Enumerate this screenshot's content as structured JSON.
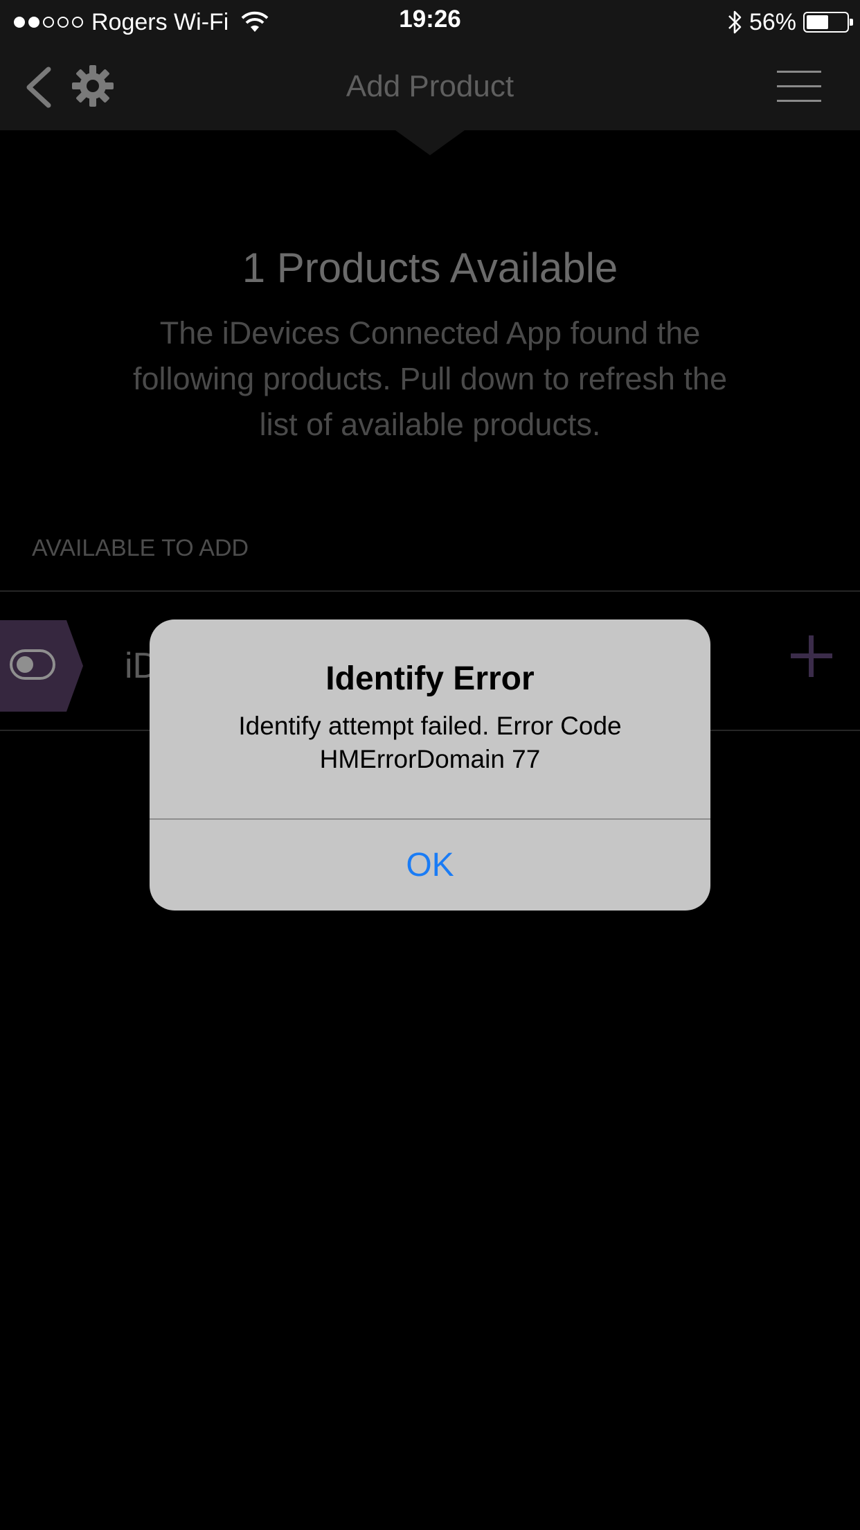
{
  "status_bar": {
    "signal_filled": 2,
    "signal_total": 5,
    "carrier": "Rogers Wi-Fi",
    "time": "19:26",
    "battery_percent": "56%",
    "battery_level": 0.56
  },
  "nav": {
    "title": "Add Product",
    "back_icon": "chevron-left-icon",
    "gear_icon": "gear-icon",
    "menu_icon": "hamburger-menu-icon"
  },
  "content": {
    "headline": "1 Products Available",
    "description": "The iDevices Connected App found the following products. Pull down to refresh the list of available products.",
    "section_label": "AVAILABLE TO ADD",
    "products": [
      {
        "name": "iD"
      }
    ]
  },
  "alert": {
    "title": "Identify Error",
    "message": "Identify attempt failed.  Error Code HMErrorDomain 77",
    "ok_label": "OK"
  },
  "colors": {
    "background": "#000000",
    "bar": "#161616",
    "badge": "#36273f",
    "accent_plus": "#3b2c4a",
    "alert_background": "#c6c6c6",
    "alert_button": "#1a7cf5"
  }
}
